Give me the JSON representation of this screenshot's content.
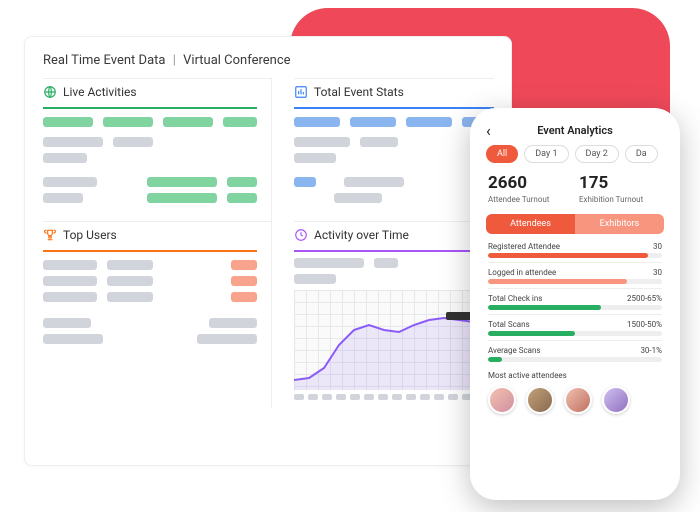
{
  "dashboard": {
    "title_left": "Real Time Event Data",
    "separator": "|",
    "title_right": "Virtual Conference",
    "panels": {
      "live_activities": {
        "label": "Live Activities"
      },
      "total_event_stats": {
        "label": "Total Event Stats"
      },
      "top_users": {
        "label": "Top Users"
      },
      "activity_over_time": {
        "label": "Activity over Time"
      }
    }
  },
  "phone": {
    "title": "Event Analytics",
    "tabs": [
      {
        "label": "All",
        "active": true
      },
      {
        "label": "Day 1",
        "active": false
      },
      {
        "label": "Day 2",
        "active": false
      },
      {
        "label": "Da",
        "active": false
      }
    ],
    "stats": {
      "attendee": {
        "value": "2660",
        "label": "Attendee Turnout"
      },
      "exhibition": {
        "value": "175",
        "label": "Exhibition Turnout"
      }
    },
    "segments": {
      "attendees": "Attendees",
      "exhibitors": "Exhibitors"
    },
    "metrics": [
      {
        "name": "Registered Attendee",
        "value": "30",
        "pct": 92,
        "color": "#f05a3c"
      },
      {
        "name": "Logged in attendee",
        "value": "30",
        "pct": 80,
        "color": "#f8957e"
      },
      {
        "name": "Total Check ins",
        "value": "2500-65%",
        "pct": 65,
        "color": "#27ae60"
      },
      {
        "name": "Total Scans",
        "value": "1500-50%",
        "pct": 50,
        "color": "#27ae60"
      },
      {
        "name": "Average Scans",
        "value": "30-1%",
        "pct": 8,
        "color": "#27ae60"
      }
    ],
    "most_active_label": "Most active attendees"
  },
  "chart_data": {
    "type": "line",
    "title": "Activity over Time",
    "x": [
      0,
      1,
      2,
      3,
      4,
      5,
      6,
      7,
      8,
      9,
      10,
      11,
      12,
      13
    ],
    "values": [
      10,
      12,
      22,
      40,
      55,
      62,
      58,
      55,
      63,
      68,
      70,
      68,
      66,
      66
    ],
    "ylim": [
      0,
      100
    ]
  }
}
